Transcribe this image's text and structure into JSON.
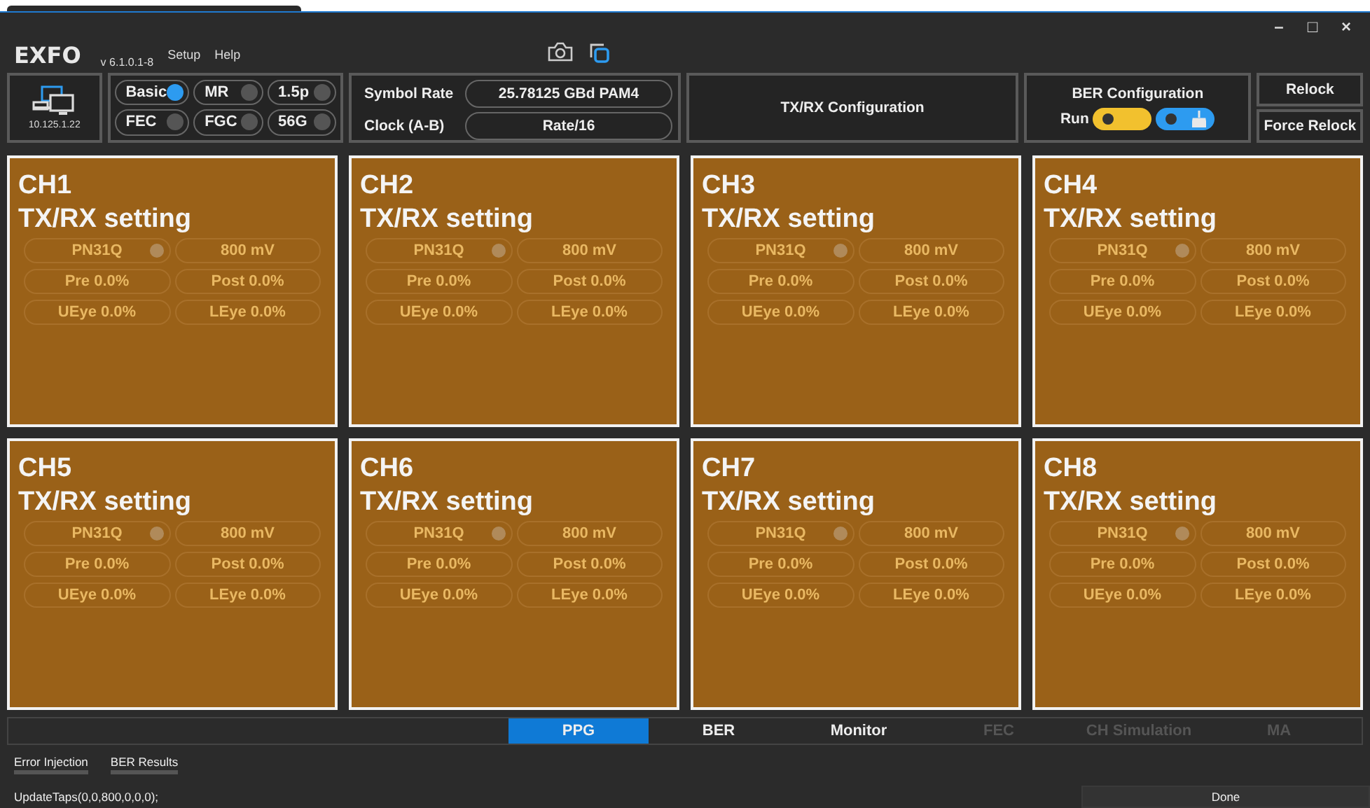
{
  "window": {
    "logo": "EXFO",
    "version": "v 6.1.0.1-8",
    "menu": [
      "Setup",
      "Help"
    ],
    "controls": [
      "–",
      "□",
      "×"
    ]
  },
  "device": {
    "ip": "10.125.1.22"
  },
  "modes": [
    {
      "label": "Basic",
      "on": true
    },
    {
      "label": "MR",
      "on": false
    },
    {
      "label": "1.5p",
      "on": false
    },
    {
      "label": "FEC",
      "on": false
    },
    {
      "label": "FGC",
      "on": false
    },
    {
      "label": "56G",
      "on": false
    }
  ],
  "symbol_rate": {
    "label": "Symbol Rate",
    "value": "25.78125 GBd PAM4"
  },
  "clock": {
    "label": "Clock (A-B)",
    "value": "Rate/16"
  },
  "txrx_configuration": "TX/RX Configuration",
  "ber_configuration": {
    "title": "BER Configuration",
    "run_label": "Run",
    "switches": [
      {
        "kind": "run",
        "on": false
      },
      {
        "kind": "clear",
        "on": false
      }
    ]
  },
  "relock_buttons": [
    "Relock",
    "Force Relock"
  ],
  "channels": [
    {
      "title": "CH1",
      "subtitle": "TX/RX setting",
      "pattern": "PN31Q",
      "amplitude": "800 mV",
      "pre": "Pre 0.0%",
      "post": "Post 0.0%",
      "ueye": "UEye 0.0%",
      "leye": "LEye 0.0%"
    },
    {
      "title": "CH2",
      "subtitle": "TX/RX setting",
      "pattern": "PN31Q",
      "amplitude": "800 mV",
      "pre": "Pre 0.0%",
      "post": "Post 0.0%",
      "ueye": "UEye 0.0%",
      "leye": "LEye 0.0%"
    },
    {
      "title": "CH3",
      "subtitle": "TX/RX setting",
      "pattern": "PN31Q",
      "amplitude": "800 mV",
      "pre": "Pre 0.0%",
      "post": "Post 0.0%",
      "ueye": "UEye 0.0%",
      "leye": "LEye 0.0%"
    },
    {
      "title": "CH4",
      "subtitle": "TX/RX setting",
      "pattern": "PN31Q",
      "amplitude": "800 mV",
      "pre": "Pre 0.0%",
      "post": "Post 0.0%",
      "ueye": "UEye 0.0%",
      "leye": "LEye 0.0%"
    },
    {
      "title": "CH5",
      "subtitle": "TX/RX setting",
      "pattern": "PN31Q",
      "amplitude": "800 mV",
      "pre": "Pre 0.0%",
      "post": "Post 0.0%",
      "ueye": "UEye 0.0%",
      "leye": "LEye 0.0%"
    },
    {
      "title": "CH6",
      "subtitle": "TX/RX setting",
      "pattern": "PN31Q",
      "amplitude": "800 mV",
      "pre": "Pre 0.0%",
      "post": "Post 0.0%",
      "ueye": "UEye 0.0%",
      "leye": "LEye 0.0%"
    },
    {
      "title": "CH7",
      "subtitle": "TX/RX setting",
      "pattern": "PN31Q",
      "amplitude": "800 mV",
      "pre": "Pre 0.0%",
      "post": "Post 0.0%",
      "ueye": "UEye 0.0%",
      "leye": "LEye 0.0%"
    },
    {
      "title": "CH8",
      "subtitle": "TX/RX setting",
      "pattern": "PN31Q",
      "amplitude": "800 mV",
      "pre": "Pre 0.0%",
      "post": "Post 0.0%",
      "ueye": "UEye 0.0%",
      "leye": "LEye 0.0%"
    }
  ],
  "main_tabs": [
    {
      "label": "PPG",
      "selected": true,
      "disabled": false
    },
    {
      "label": "BER",
      "selected": false,
      "disabled": false
    },
    {
      "label": "Monitor",
      "selected": false,
      "disabled": false
    },
    {
      "label": "FEC",
      "selected": false,
      "disabled": true
    },
    {
      "label": "CH Simulation",
      "selected": false,
      "disabled": true
    },
    {
      "label": "MA",
      "selected": false,
      "disabled": true
    }
  ],
  "sub_tabs": [
    {
      "label": "Error Injection",
      "selected": false
    },
    {
      "label": "BER Results",
      "selected": false
    }
  ],
  "status_bar": {
    "message": "UpdateTaps(0,0,800,0,0,0);",
    "button": "Done"
  }
}
